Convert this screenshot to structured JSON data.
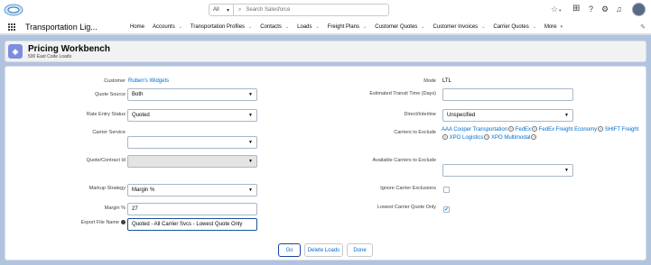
{
  "header": {
    "search_scope": "All",
    "search_placeholder": "Search Salesforce"
  },
  "icons": {
    "star": "star-icon",
    "add": "plus-icon",
    "help": "help-icon",
    "setup": "gear-icon",
    "notifications": "bell-icon",
    "edit_nav": "pencil-icon"
  },
  "nav": {
    "app_name": "Transportation Lig...",
    "items": [
      {
        "label": "Home"
      },
      {
        "label": "Accounts"
      },
      {
        "label": "Transportation Profiles"
      },
      {
        "label": "Contacts"
      },
      {
        "label": "Loads"
      },
      {
        "label": "Freight Plans"
      },
      {
        "label": "Customer Quotes"
      },
      {
        "label": "Customer Invoices"
      },
      {
        "label": "Carrier Quotes"
      },
      {
        "label": "More"
      }
    ]
  },
  "page": {
    "title": "Pricing Workbench",
    "subtitle": "500 East Code Loads"
  },
  "form": {
    "customer_label": "Customer",
    "customer_value": "Ruben's Widgets",
    "quote_source_label": "Quote Source",
    "quote_source_value": "Both",
    "rate_entry_label": "Rate Entry Status",
    "rate_entry_value": "Quoted",
    "carrier_service_label": "Carrier Service",
    "carrier_service_value": "",
    "quote_contract_label": "Quote/Contract Id",
    "quote_contract_value": "",
    "markup_strategy_label": "Markup Strategy",
    "markup_strategy_value": "Margin %",
    "margin_label": "Margin %",
    "margin_value": "27",
    "export_label": "Export File Name",
    "export_value": "Quoted - All Carrier Svcs - Lowest Quote Only",
    "mode_label": "Mode",
    "mode_value": "LTL",
    "transit_label": "Estimated Transit Time (Days)",
    "transit_value": "",
    "direct_label": "Direct/Interline",
    "direct_value": "Unspecified",
    "exclude_label": "Carriers to Exclude",
    "exclude_carriers": [
      "AAA Cooper Transportation",
      "FedEx",
      "FedEx Freight Economy",
      "SHIFT Freight",
      "XPO Logistics",
      "XPO Multimodal"
    ],
    "available_label": "Available Carriers to Exclude",
    "available_value": "",
    "ignore_label": "Ignore Carrier Exclusions",
    "ignore_checked": false,
    "lowest_label": "Lowest Carrier Quote Only",
    "lowest_checked": true
  },
  "buttons": {
    "go": "Go",
    "delete_loads": "Delete Loads",
    "done": "Done"
  }
}
